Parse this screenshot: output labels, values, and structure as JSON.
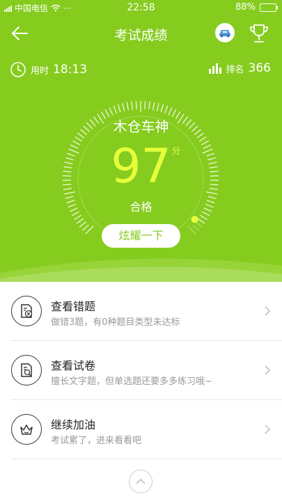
{
  "status_bar": {
    "carrier": "中国电信",
    "time": "22:58",
    "battery": "88%",
    "battery_level": 0.88
  },
  "nav": {
    "title": "考试成绩",
    "back_icon": "back-arrow-icon",
    "car_icon": "car-icon",
    "trophy_icon": "trophy-icon"
  },
  "stats": {
    "time_label": "用时",
    "time_value": "18:13",
    "rank_label": "排名",
    "rank_value": "366"
  },
  "result": {
    "name": "木仓车神",
    "score": "97",
    "unit": "分",
    "status": "合格",
    "score_fraction": 0.97,
    "share_button": "炫耀一下"
  },
  "list": [
    {
      "icon": "wrong-answers-icon",
      "title": "查看错题",
      "subtitle": "做错3题，有0种题目类型未达标"
    },
    {
      "icon": "exam-paper-icon",
      "title": "查看试卷",
      "subtitle": "擅长文字题，但单选题还要多多练习哦~"
    },
    {
      "icon": "crown-icon",
      "title": "继续加油",
      "subtitle": "考试累了，进来看看吧"
    }
  ],
  "colors": {
    "brand_green": "#86cc1f",
    "score_yellow": "#e6ff3b"
  }
}
